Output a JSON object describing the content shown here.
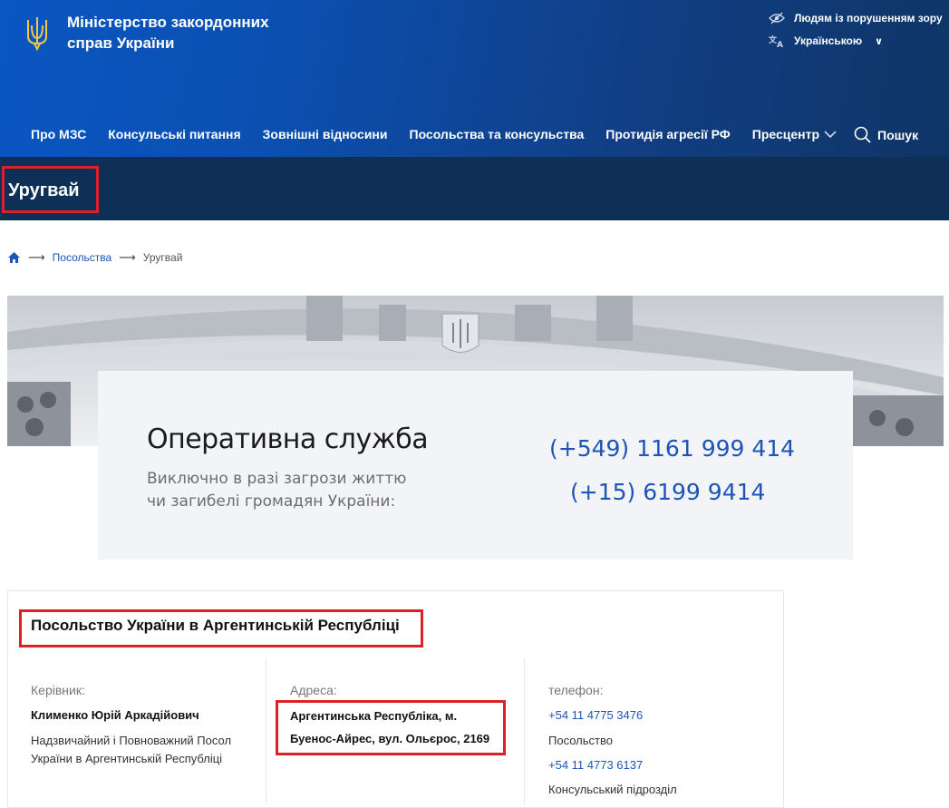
{
  "brand": {
    "line1": "Міністерство закордонних",
    "line2": "справ України"
  },
  "utility": {
    "accessibility": "Людям із порушенням зору",
    "language": "Українською"
  },
  "nav": {
    "items": [
      "Про МЗС",
      "Консульські питання",
      "Зовнішні відносини",
      "Посольства та консульства",
      "Протидія агресії РФ",
      "Пресцентр"
    ],
    "search": "Пошук"
  },
  "page_title": "Уругвай",
  "breadcrumb": {
    "link": "Посольства",
    "current": "Уругвай"
  },
  "emergency": {
    "title": "Оперативна служба",
    "subtitle_line1": "Виключно в разі загрози життю",
    "subtitle_line2": "чи загибелі громадян України:",
    "phone1": "(+549) 1161 999 414",
    "phone2": "(+15) 6199 9414"
  },
  "embassy": {
    "title": "Посольство України в Аргентинській Республіці",
    "head_label": "Керівник:",
    "head_name": "Клименко Юрій Аркадійович",
    "head_position": "Надзвичайний і Повноважний Посол України в Аргентинській Республіці",
    "address_label": "Адреса:",
    "address_line1": "Аргентинська Республіка, м.",
    "address_line2": "Буенос-Айрес, вул. Ольєрос, 2169",
    "phone_label": "телефон:",
    "phone1": "+54 11 4775 3476",
    "phone1_note": "Посольство",
    "phone2": "+54 11 4773 6137",
    "phone2_note": "Консульський підрозділ"
  },
  "colors": {
    "header_blue": "#0b4fb0",
    "title_band": "#0e3056",
    "link": "#1c55b5",
    "highlight": "#d9222a"
  },
  "icons": [
    "trident-logo-icon",
    "eye-accessibility-icon",
    "translate-icon",
    "chevron-down-icon",
    "search-icon",
    "home-icon",
    "arrow-right-icon"
  ]
}
